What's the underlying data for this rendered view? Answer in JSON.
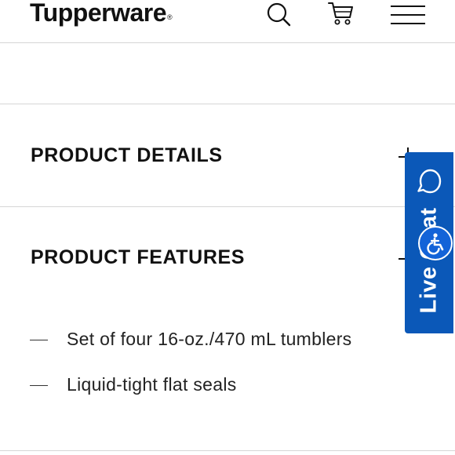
{
  "header": {
    "logo_text": "Tupperware",
    "logo_mark": "®",
    "icons": [
      "search-icon",
      "cart-icon",
      "hamburger-menu-icon"
    ]
  },
  "accordion": [
    {
      "title": "PRODUCT DETAILS",
      "icon": "plus-icon",
      "expanded": false
    },
    {
      "title": "PRODUCT FEATURES",
      "icon": "plus-icon",
      "expanded": true
    }
  ],
  "features": [
    "Set of four 16-oz./470 mL tumblers",
    "Liquid-tight flat seals"
  ],
  "live_chat": {
    "label": "Live Chat",
    "icon": "chat-bubble-icon",
    "color": "#0b58b8"
  },
  "accessibility": {
    "icon": "wheelchair-icon",
    "color": "#1363d8"
  },
  "colors": {
    "text": "#111111",
    "divider": "#d6d6d6",
    "background": "#ffffff"
  }
}
